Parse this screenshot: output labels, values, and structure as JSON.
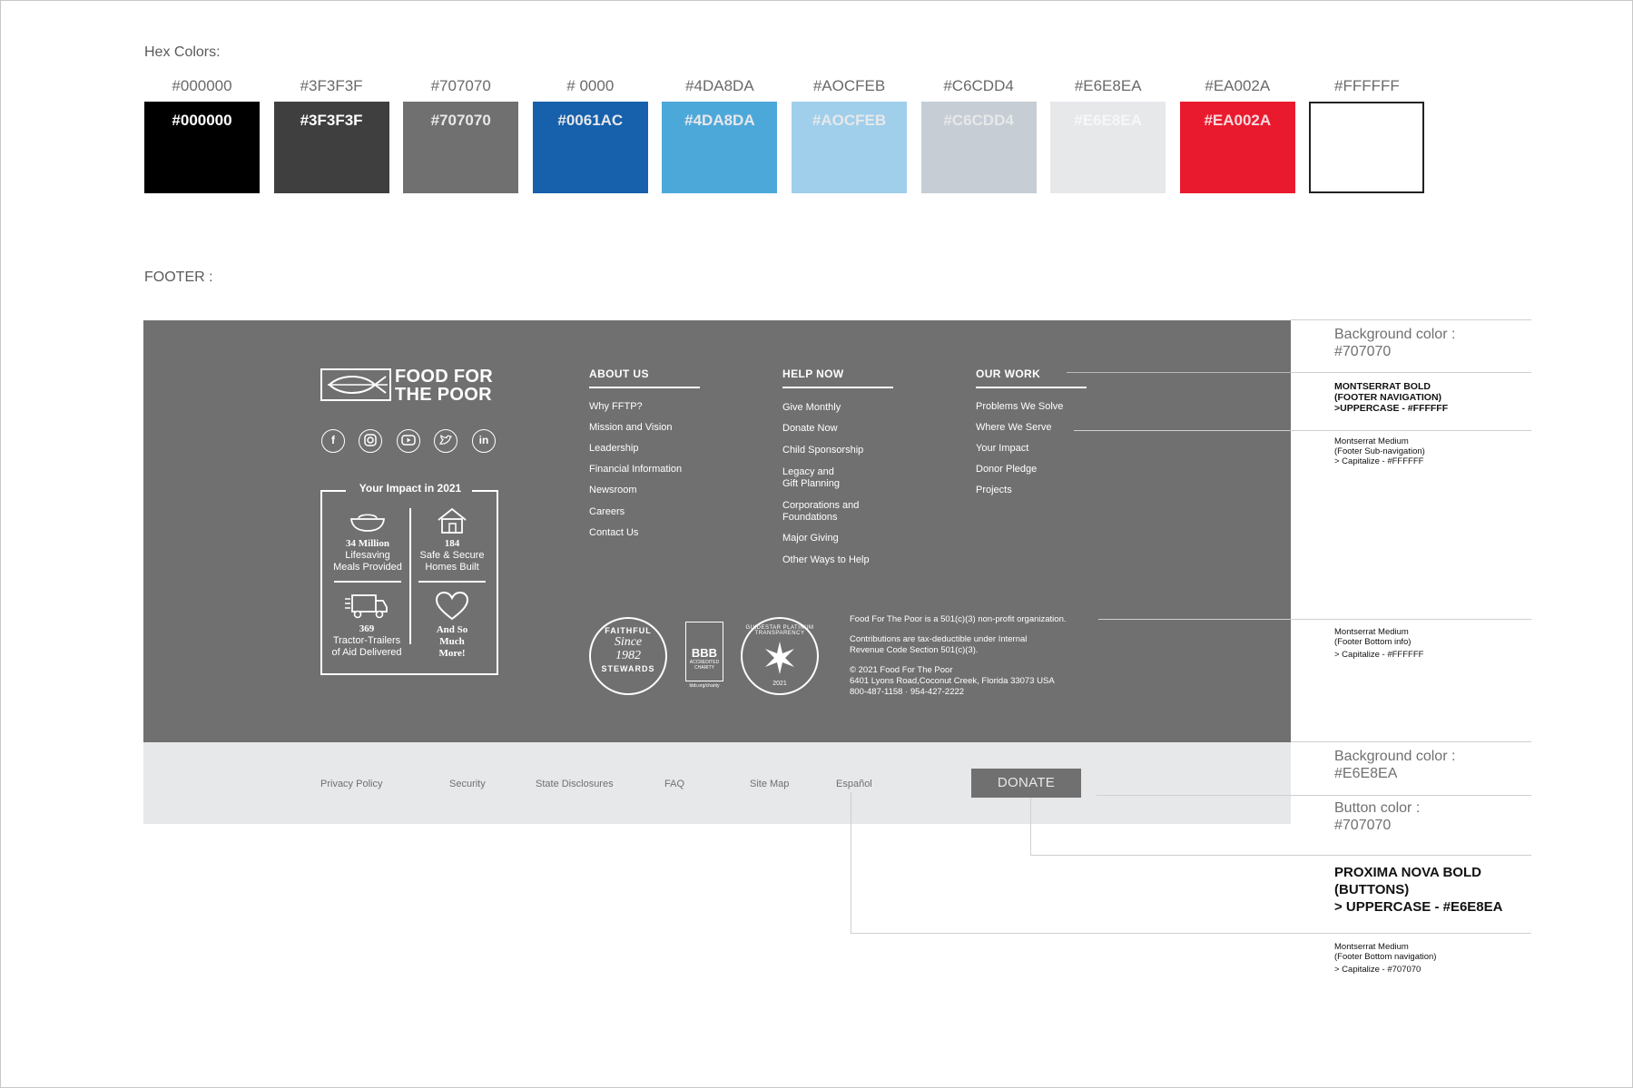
{
  "hex_section": {
    "title": "Hex Colors:",
    "swatches": [
      {
        "top_label": "#000000",
        "label": "#000000",
        "color": "#000000",
        "text_color": "#FFFFFF"
      },
      {
        "top_label": "#3F3F3F",
        "label": "#3F3F3F",
        "color": "#3F3F3F",
        "text_color": "#FFFFFF"
      },
      {
        "top_label": "#707070",
        "label": "#707070",
        "color": "#707070",
        "text_color": "#E6E8EA"
      },
      {
        "top_label": "# 0000",
        "label": "#0061AC",
        "color": "#1660AC",
        "text_color": "#E6E8EA"
      },
      {
        "top_label": "#4DA8DA",
        "label": "#4DA8DA",
        "color": "#4DA8DA",
        "text_color": "#E6E8EA"
      },
      {
        "top_label": "#AOCFEB",
        "label": "#AOCFEB",
        "color": "#A0CFEB",
        "text_color": "#E6E8EA"
      },
      {
        "top_label": "#C6CDD4",
        "label": "#C6CDD4",
        "color": "#C6CDD4",
        "text_color": "#E6E8EA"
      },
      {
        "top_label": "#E6E8EA",
        "label": "#E6E8EA",
        "color": "#E6E8EA",
        "text_color": "#F7F7F7"
      },
      {
        "top_label": "#EA002A",
        "label": "#EA002A",
        "color": "#EA1A2E",
        "text_color": "#F7D9DC"
      },
      {
        "top_label": "#FFFFFF",
        "label": "",
        "color": "#FFFFFF",
        "text_color": "#FFFFFF"
      }
    ]
  },
  "footer_section": {
    "title": "FOOTER :",
    "logo": {
      "line1": "FOOD FOR",
      "line2": "THE POOR"
    },
    "social_icons": [
      "facebook-icon",
      "instagram-icon",
      "youtube-icon",
      "twitter-icon",
      "linkedin-icon"
    ],
    "impact": {
      "title": "Your Impact in 2021",
      "stats": [
        {
          "value": "34 Million",
          "line1": "Lifesaving",
          "line2": "Meals Provided"
        },
        {
          "value": "184",
          "line1": "Safe & Secure",
          "line2": "Homes Built"
        },
        {
          "value": "369",
          "line1": "Tractor-Trailers",
          "line2": "of Aid Delivered"
        },
        {
          "value": "And So",
          "line1": "Much",
          "line2": "More!"
        }
      ]
    },
    "nav": {
      "about": {
        "heading": "ABOUT US",
        "items": [
          "Why FFTP?",
          "Mission and Vision",
          "Leadership",
          "Financial Information",
          "Newsroom",
          "Careers",
          "Contact Us"
        ]
      },
      "help": {
        "heading": "HELP NOW",
        "items": [
          "Give Monthly",
          "Donate Now",
          "Child Sponsorship",
          "Legacy and",
          "Gift Planning",
          "Corporations and",
          "Foundations",
          "Major Giving",
          "Other Ways to Help"
        ]
      },
      "work": {
        "heading": "OUR WORK",
        "items": [
          "Problems We Solve",
          "Where We Serve",
          "Your Impact",
          "Donor Pledge",
          "Projects"
        ]
      }
    },
    "badges": {
      "faithful": {
        "top": "FAITHFUL",
        "middle1": "Since",
        "middle2": "1982",
        "bottom": "STEWARDS"
      },
      "bbb": {
        "mark": "BBB",
        "line1": "ACCREDITED",
        "line2": "CHARITY",
        "url": "bbb.org/charity"
      },
      "guidestar": {
        "arc": "GUIDESTAR PLATINUM TRANSPARENCY",
        "year": "2021"
      }
    },
    "info": {
      "line1": "Food For The Poor is a 501(c)(3)  non-profit organization.",
      "line2": "Contributions are tax-deductible under Internal",
      "line3": "Revenue Code Section 501(c)(3).",
      "line4": "© 2021 Food For The Poor",
      "line5": "6401 Lyons Road,Coconut Creek, Florida 33073 USA",
      "line6": "800-487-1158  ·  954-427-2222"
    },
    "bottom_links": [
      "Privacy Policy",
      "Security",
      "State Disclosures",
      "FAQ",
      "Site Map",
      "Español"
    ],
    "donate_label": "DONATE"
  },
  "annotations": {
    "bg_dark_label": "Background color :",
    "bg_dark_value": "#707070",
    "nav_font_line1": "MONTSERRAT BOLD",
    "nav_font_line2": "(FOOTER NAVIGATION)",
    "nav_font_line3": ">UPPERCASE - #FFFFFF",
    "subnav_line1": "Montserrat Medium",
    "subnav_line2": "(Footer Sub-navigation)",
    "subnav_line3": "> Capitalize - #FFFFFF",
    "info_line1": "Montserrat Medium",
    "info_line2": "(Footer Bottom info)",
    "info_line3": "> Capitalize - #FFFFFF",
    "bg_light_label": "Background color :",
    "bg_light_value": "#E6E8EA",
    "button_label": "Button color :",
    "button_value": "#707070",
    "button_font_line1": "PROXIMA NOVA BOLD",
    "button_font_line2": "(BUTTONS)",
    "button_font_line3": "> UPPERCASE - #E6E8EA",
    "bottom_nav_line1": "Montserrat Medium",
    "bottom_nav_line2": "(Footer Bottom navigation)",
    "bottom_nav_line3": "> Capitalize - #707070"
  }
}
